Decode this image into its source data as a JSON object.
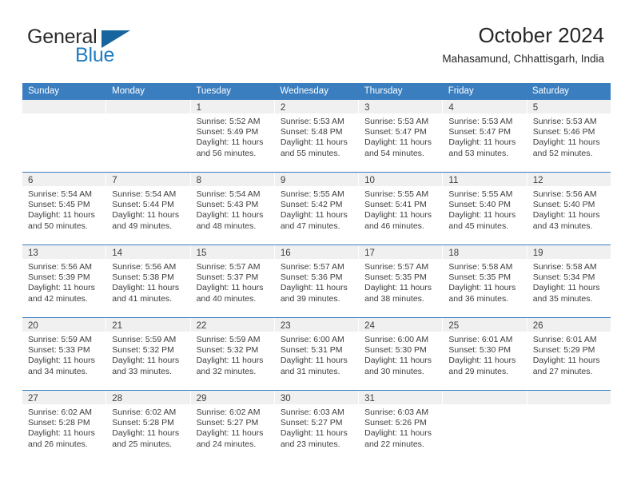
{
  "logo": {
    "word_top": "General",
    "word_bottom": "Blue",
    "accent_color": "#17659f",
    "blue_text_color": "#1f7dc2"
  },
  "header": {
    "title": "October 2024",
    "subtitle": "Mahasamund, Chhattisgarh, India"
  },
  "theme": {
    "header_blue": "#3a7ec0",
    "day_band_gray": "#f0f0f0",
    "text_color": "#3d3d3d"
  },
  "weekdays": [
    "Sunday",
    "Monday",
    "Tuesday",
    "Wednesday",
    "Thursday",
    "Friday",
    "Saturday"
  ],
  "weeks": [
    [
      {
        "day": "",
        "sunrise": "",
        "sunset": "",
        "daylight1": "",
        "daylight2": ""
      },
      {
        "day": "",
        "sunrise": "",
        "sunset": "",
        "daylight1": "",
        "daylight2": ""
      },
      {
        "day": "1",
        "sunrise": "Sunrise: 5:52 AM",
        "sunset": "Sunset: 5:49 PM",
        "daylight1": "Daylight: 11 hours",
        "daylight2": "and 56 minutes."
      },
      {
        "day": "2",
        "sunrise": "Sunrise: 5:53 AM",
        "sunset": "Sunset: 5:48 PM",
        "daylight1": "Daylight: 11 hours",
        "daylight2": "and 55 minutes."
      },
      {
        "day": "3",
        "sunrise": "Sunrise: 5:53 AM",
        "sunset": "Sunset: 5:47 PM",
        "daylight1": "Daylight: 11 hours",
        "daylight2": "and 54 minutes."
      },
      {
        "day": "4",
        "sunrise": "Sunrise: 5:53 AM",
        "sunset": "Sunset: 5:47 PM",
        "daylight1": "Daylight: 11 hours",
        "daylight2": "and 53 minutes."
      },
      {
        "day": "5",
        "sunrise": "Sunrise: 5:53 AM",
        "sunset": "Sunset: 5:46 PM",
        "daylight1": "Daylight: 11 hours",
        "daylight2": "and 52 minutes."
      }
    ],
    [
      {
        "day": "6",
        "sunrise": "Sunrise: 5:54 AM",
        "sunset": "Sunset: 5:45 PM",
        "daylight1": "Daylight: 11 hours",
        "daylight2": "and 50 minutes."
      },
      {
        "day": "7",
        "sunrise": "Sunrise: 5:54 AM",
        "sunset": "Sunset: 5:44 PM",
        "daylight1": "Daylight: 11 hours",
        "daylight2": "and 49 minutes."
      },
      {
        "day": "8",
        "sunrise": "Sunrise: 5:54 AM",
        "sunset": "Sunset: 5:43 PM",
        "daylight1": "Daylight: 11 hours",
        "daylight2": "and 48 minutes."
      },
      {
        "day": "9",
        "sunrise": "Sunrise: 5:55 AM",
        "sunset": "Sunset: 5:42 PM",
        "daylight1": "Daylight: 11 hours",
        "daylight2": "and 47 minutes."
      },
      {
        "day": "10",
        "sunrise": "Sunrise: 5:55 AM",
        "sunset": "Sunset: 5:41 PM",
        "daylight1": "Daylight: 11 hours",
        "daylight2": "and 46 minutes."
      },
      {
        "day": "11",
        "sunrise": "Sunrise: 5:55 AM",
        "sunset": "Sunset: 5:40 PM",
        "daylight1": "Daylight: 11 hours",
        "daylight2": "and 45 minutes."
      },
      {
        "day": "12",
        "sunrise": "Sunrise: 5:56 AM",
        "sunset": "Sunset: 5:40 PM",
        "daylight1": "Daylight: 11 hours",
        "daylight2": "and 43 minutes."
      }
    ],
    [
      {
        "day": "13",
        "sunrise": "Sunrise: 5:56 AM",
        "sunset": "Sunset: 5:39 PM",
        "daylight1": "Daylight: 11 hours",
        "daylight2": "and 42 minutes."
      },
      {
        "day": "14",
        "sunrise": "Sunrise: 5:56 AM",
        "sunset": "Sunset: 5:38 PM",
        "daylight1": "Daylight: 11 hours",
        "daylight2": "and 41 minutes."
      },
      {
        "day": "15",
        "sunrise": "Sunrise: 5:57 AM",
        "sunset": "Sunset: 5:37 PM",
        "daylight1": "Daylight: 11 hours",
        "daylight2": "and 40 minutes."
      },
      {
        "day": "16",
        "sunrise": "Sunrise: 5:57 AM",
        "sunset": "Sunset: 5:36 PM",
        "daylight1": "Daylight: 11 hours",
        "daylight2": "and 39 minutes."
      },
      {
        "day": "17",
        "sunrise": "Sunrise: 5:57 AM",
        "sunset": "Sunset: 5:35 PM",
        "daylight1": "Daylight: 11 hours",
        "daylight2": "and 38 minutes."
      },
      {
        "day": "18",
        "sunrise": "Sunrise: 5:58 AM",
        "sunset": "Sunset: 5:35 PM",
        "daylight1": "Daylight: 11 hours",
        "daylight2": "and 36 minutes."
      },
      {
        "day": "19",
        "sunrise": "Sunrise: 5:58 AM",
        "sunset": "Sunset: 5:34 PM",
        "daylight1": "Daylight: 11 hours",
        "daylight2": "and 35 minutes."
      }
    ],
    [
      {
        "day": "20",
        "sunrise": "Sunrise: 5:59 AM",
        "sunset": "Sunset: 5:33 PM",
        "daylight1": "Daylight: 11 hours",
        "daylight2": "and 34 minutes."
      },
      {
        "day": "21",
        "sunrise": "Sunrise: 5:59 AM",
        "sunset": "Sunset: 5:32 PM",
        "daylight1": "Daylight: 11 hours",
        "daylight2": "and 33 minutes."
      },
      {
        "day": "22",
        "sunrise": "Sunrise: 5:59 AM",
        "sunset": "Sunset: 5:32 PM",
        "daylight1": "Daylight: 11 hours",
        "daylight2": "and 32 minutes."
      },
      {
        "day": "23",
        "sunrise": "Sunrise: 6:00 AM",
        "sunset": "Sunset: 5:31 PM",
        "daylight1": "Daylight: 11 hours",
        "daylight2": "and 31 minutes."
      },
      {
        "day": "24",
        "sunrise": "Sunrise: 6:00 AM",
        "sunset": "Sunset: 5:30 PM",
        "daylight1": "Daylight: 11 hours",
        "daylight2": "and 30 minutes."
      },
      {
        "day": "25",
        "sunrise": "Sunrise: 6:01 AM",
        "sunset": "Sunset: 5:30 PM",
        "daylight1": "Daylight: 11 hours",
        "daylight2": "and 29 minutes."
      },
      {
        "day": "26",
        "sunrise": "Sunrise: 6:01 AM",
        "sunset": "Sunset: 5:29 PM",
        "daylight1": "Daylight: 11 hours",
        "daylight2": "and 27 minutes."
      }
    ],
    [
      {
        "day": "27",
        "sunrise": "Sunrise: 6:02 AM",
        "sunset": "Sunset: 5:28 PM",
        "daylight1": "Daylight: 11 hours",
        "daylight2": "and 26 minutes."
      },
      {
        "day": "28",
        "sunrise": "Sunrise: 6:02 AM",
        "sunset": "Sunset: 5:28 PM",
        "daylight1": "Daylight: 11 hours",
        "daylight2": "and 25 minutes."
      },
      {
        "day": "29",
        "sunrise": "Sunrise: 6:02 AM",
        "sunset": "Sunset: 5:27 PM",
        "daylight1": "Daylight: 11 hours",
        "daylight2": "and 24 minutes."
      },
      {
        "day": "30",
        "sunrise": "Sunrise: 6:03 AM",
        "sunset": "Sunset: 5:27 PM",
        "daylight1": "Daylight: 11 hours",
        "daylight2": "and 23 minutes."
      },
      {
        "day": "31",
        "sunrise": "Sunrise: 6:03 AM",
        "sunset": "Sunset: 5:26 PM",
        "daylight1": "Daylight: 11 hours",
        "daylight2": "and 22 minutes."
      },
      {
        "day": "",
        "sunrise": "",
        "sunset": "",
        "daylight1": "",
        "daylight2": ""
      },
      {
        "day": "",
        "sunrise": "",
        "sunset": "",
        "daylight1": "",
        "daylight2": ""
      }
    ]
  ]
}
